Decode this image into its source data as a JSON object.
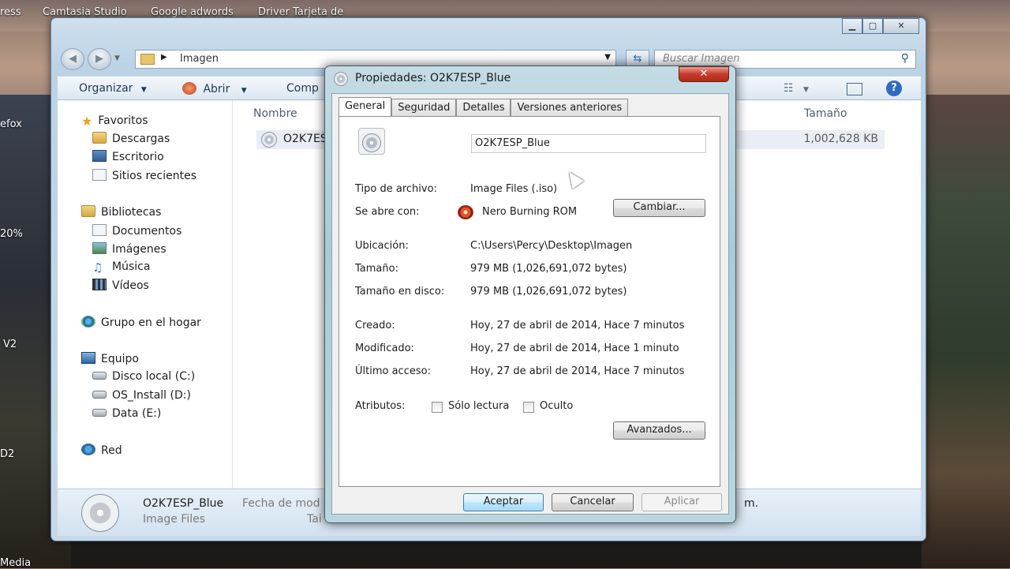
{
  "desktop": {
    "icons": [
      "ress",
      "Camtasia Studio",
      "Google adwords",
      "Driver Tarjeta de",
      "efox",
      "20%",
      "V2",
      "D2",
      "Media"
    ]
  },
  "explorer": {
    "address": {
      "path": "Imagen"
    },
    "search": {
      "placeholder": "Buscar Imagen"
    },
    "toolbar": {
      "organize": "Organizar",
      "open": "Abrir",
      "compress": "Comp"
    },
    "nav": {
      "favorites": {
        "label": "Favoritos",
        "items": [
          "Descargas",
          "Escritorio",
          "Sitios recientes"
        ]
      },
      "libraries": {
        "label": "Bibliotecas",
        "items": [
          "Documentos",
          "Imágenes",
          "Música",
          "Vídeos"
        ]
      },
      "homegroup": "Grupo en el hogar",
      "computer": {
        "label": "Equipo",
        "items": [
          "Disco local (C:)",
          "OS_Install (D:)",
          "Data (E:)"
        ]
      },
      "network": "Red"
    },
    "columns": {
      "name": "Nombre",
      "size": "Tamaño"
    },
    "files": [
      {
        "name": "O2K7ESP",
        "size": "1,002,628 KB"
      }
    ],
    "details_pane": {
      "name": "O2K7ESP_Blue",
      "type": "Image Files",
      "modified_label": "Fecha de mod",
      "size_label": "Tai",
      "trailing": "m."
    }
  },
  "dialog": {
    "title": "Propiedades: O2K7ESP_Blue",
    "close_glyph": "✕",
    "tabs": [
      "General",
      "Seguridad",
      "Detalles",
      "Versiones anteriores"
    ],
    "active_tab": "General",
    "file_name": "O2K7ESP_Blue",
    "props": {
      "type_label": "Tipo de archivo:",
      "type_value": "Image Files (.iso)",
      "opens_label": "Se abre con:",
      "opens_value": "Nero Burning ROM",
      "change_button": "Cambiar...",
      "location_label": "Ubicación:",
      "location_value": "C:\\Users\\Percy\\Desktop\\Imagen",
      "size_label": "Tamaño:",
      "size_value": "979 MB (1,026,691,072 bytes)",
      "disk_size_label": "Tamaño en disco:",
      "disk_size_value": "979 MB (1,026,691,072 bytes)",
      "created_label": "Creado:",
      "created_value": "Hoy, 27 de abril de 2014, Hace 7 minutos",
      "modified_label": "Modificado:",
      "modified_value": "Hoy, 27 de abril de 2014, Hace 1 minuto",
      "accessed_label": "Último acceso:",
      "accessed_value": "Hoy, 27 de abril de 2014, Hace 7 minutos",
      "attributes_label": "Atributos:",
      "readonly_label": "Sólo lectura",
      "hidden_label": "Oculto",
      "advanced_button": "Avanzados..."
    },
    "buttons": {
      "accept": "Aceptar",
      "cancel": "Cancelar",
      "apply": "Aplicar"
    }
  }
}
